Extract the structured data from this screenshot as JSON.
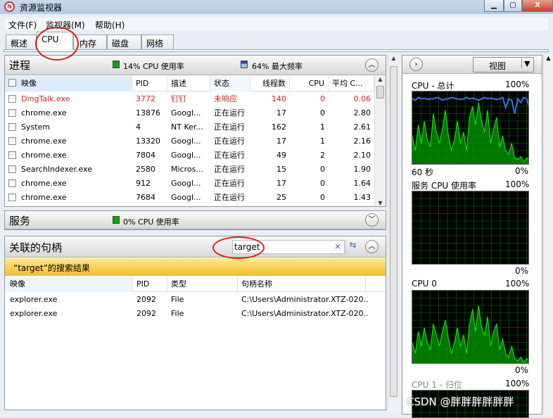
{
  "window": {
    "title": "资源监视器",
    "icon": "resource-monitor-icon",
    "buttons": [
      "minimize",
      "maximize",
      "close"
    ]
  },
  "menu": [
    "文件(F)",
    "监视器(M)",
    "帮助(H)"
  ],
  "tabs": [
    {
      "label": "概述"
    },
    {
      "label": "CPU",
      "active": true
    },
    {
      "label": "内存"
    },
    {
      "label": "磁盘"
    },
    {
      "label": "网络"
    }
  ],
  "processes": {
    "title": "进程",
    "cpu_usage": "14% CPU 使用率",
    "max_freq": "64% 最大频率",
    "columns": [
      "映像",
      "PID",
      "描述",
      "状态",
      "线程数",
      "CPU",
      "平均 C..."
    ],
    "rows": [
      [
        "DingTalk.exe",
        "3772",
        "钉钉",
        "未响应",
        "140",
        "0",
        "0.06"
      ],
      [
        "chrome.exe",
        "13876",
        "Googl...",
        "正在运行",
        "17",
        "0",
        "2.80"
      ],
      [
        "System",
        "4",
        "NT Ker...",
        "正在运行",
        "162",
        "1",
        "2.61"
      ],
      [
        "chrome.exe",
        "13320",
        "Googl...",
        "正在运行",
        "17",
        "1",
        "2.16"
      ],
      [
        "chrome.exe",
        "7804",
        "Googl...",
        "正在运行",
        "49",
        "2",
        "2.10"
      ],
      [
        "SearchIndexer.exe",
        "2580",
        "Micros...",
        "正在运行",
        "15",
        "0",
        "1.90"
      ],
      [
        "chrome.exe",
        "912",
        "Googl...",
        "正在运行",
        "17",
        "0",
        "1.64"
      ],
      [
        "chrome.exe",
        "7684",
        "Googl...",
        "正在运行",
        "25",
        "0",
        "1.43"
      ]
    ],
    "highlight_color": "#e0201a"
  },
  "services": {
    "title": "服务",
    "cpu_usage": "0% CPU 使用率"
  },
  "handles": {
    "title": "关联的句柄",
    "search_value": "target",
    "result_banner": "“target”的搜索结果",
    "columns": [
      "映像",
      "PID",
      "类型",
      "句柄名称"
    ],
    "rows": [
      [
        "explorer.exe",
        "2092",
        "File",
        "C:\\Users\\Administrator.XTZ-020..."
      ],
      [
        "explorer.exe",
        "2092",
        "File",
        "C:\\Users\\Administrator.XTZ-020..."
      ]
    ]
  },
  "right": {
    "view_label": "视图",
    "graphs": [
      {
        "title": "CPU - 总计",
        "max": "100%",
        "footer_left": "60 秒",
        "footer_right": "0%",
        "values": [
          40,
          20,
          55,
          30,
          60,
          35,
          25,
          70,
          45,
          30,
          50,
          75,
          40,
          20,
          35,
          60,
          30,
          45,
          20,
          65,
          80,
          55,
          85,
          60,
          45,
          75,
          30,
          50,
          65,
          25,
          40,
          20,
          15,
          30,
          10,
          8,
          12,
          5,
          10,
          8
        ],
        "freq": [
          90,
          88,
          92,
          90,
          91,
          89,
          90,
          90,
          92,
          91,
          88,
          90,
          90,
          92,
          91,
          90,
          89,
          90,
          92,
          90,
          91,
          90,
          88,
          90,
          92,
          90,
          91,
          90,
          89,
          90,
          92,
          78,
          90,
          88,
          70,
          90,
          85,
          92,
          90,
          75
        ]
      },
      {
        "title": "服务 CPU 使用率",
        "max": "100%",
        "footer_right": "0%",
        "values": []
      },
      {
        "title": "CPU 0",
        "max": "100%",
        "footer_right": "0%",
        "values": [
          30,
          15,
          45,
          25,
          50,
          30,
          20,
          55,
          40,
          25,
          45,
          60,
          35,
          15,
          30,
          50,
          25,
          40,
          15,
          55,
          75,
          45,
          80,
          50,
          40,
          65,
          25,
          45,
          55,
          20,
          35,
          15,
          10,
          25,
          8,
          5,
          10,
          3,
          8,
          5
        ]
      },
      {
        "title": "CPU 1 - 归位",
        "max": "100%"
      }
    ]
  },
  "watermark": "CSDN @胖胖胖胖胖胖",
  "colors": {
    "graph_line": "#00ff00",
    "graph_fill": "#009400",
    "freq_line": "#3b6fe0",
    "banner": "#f8d050",
    "annotation": "#e0201a"
  }
}
